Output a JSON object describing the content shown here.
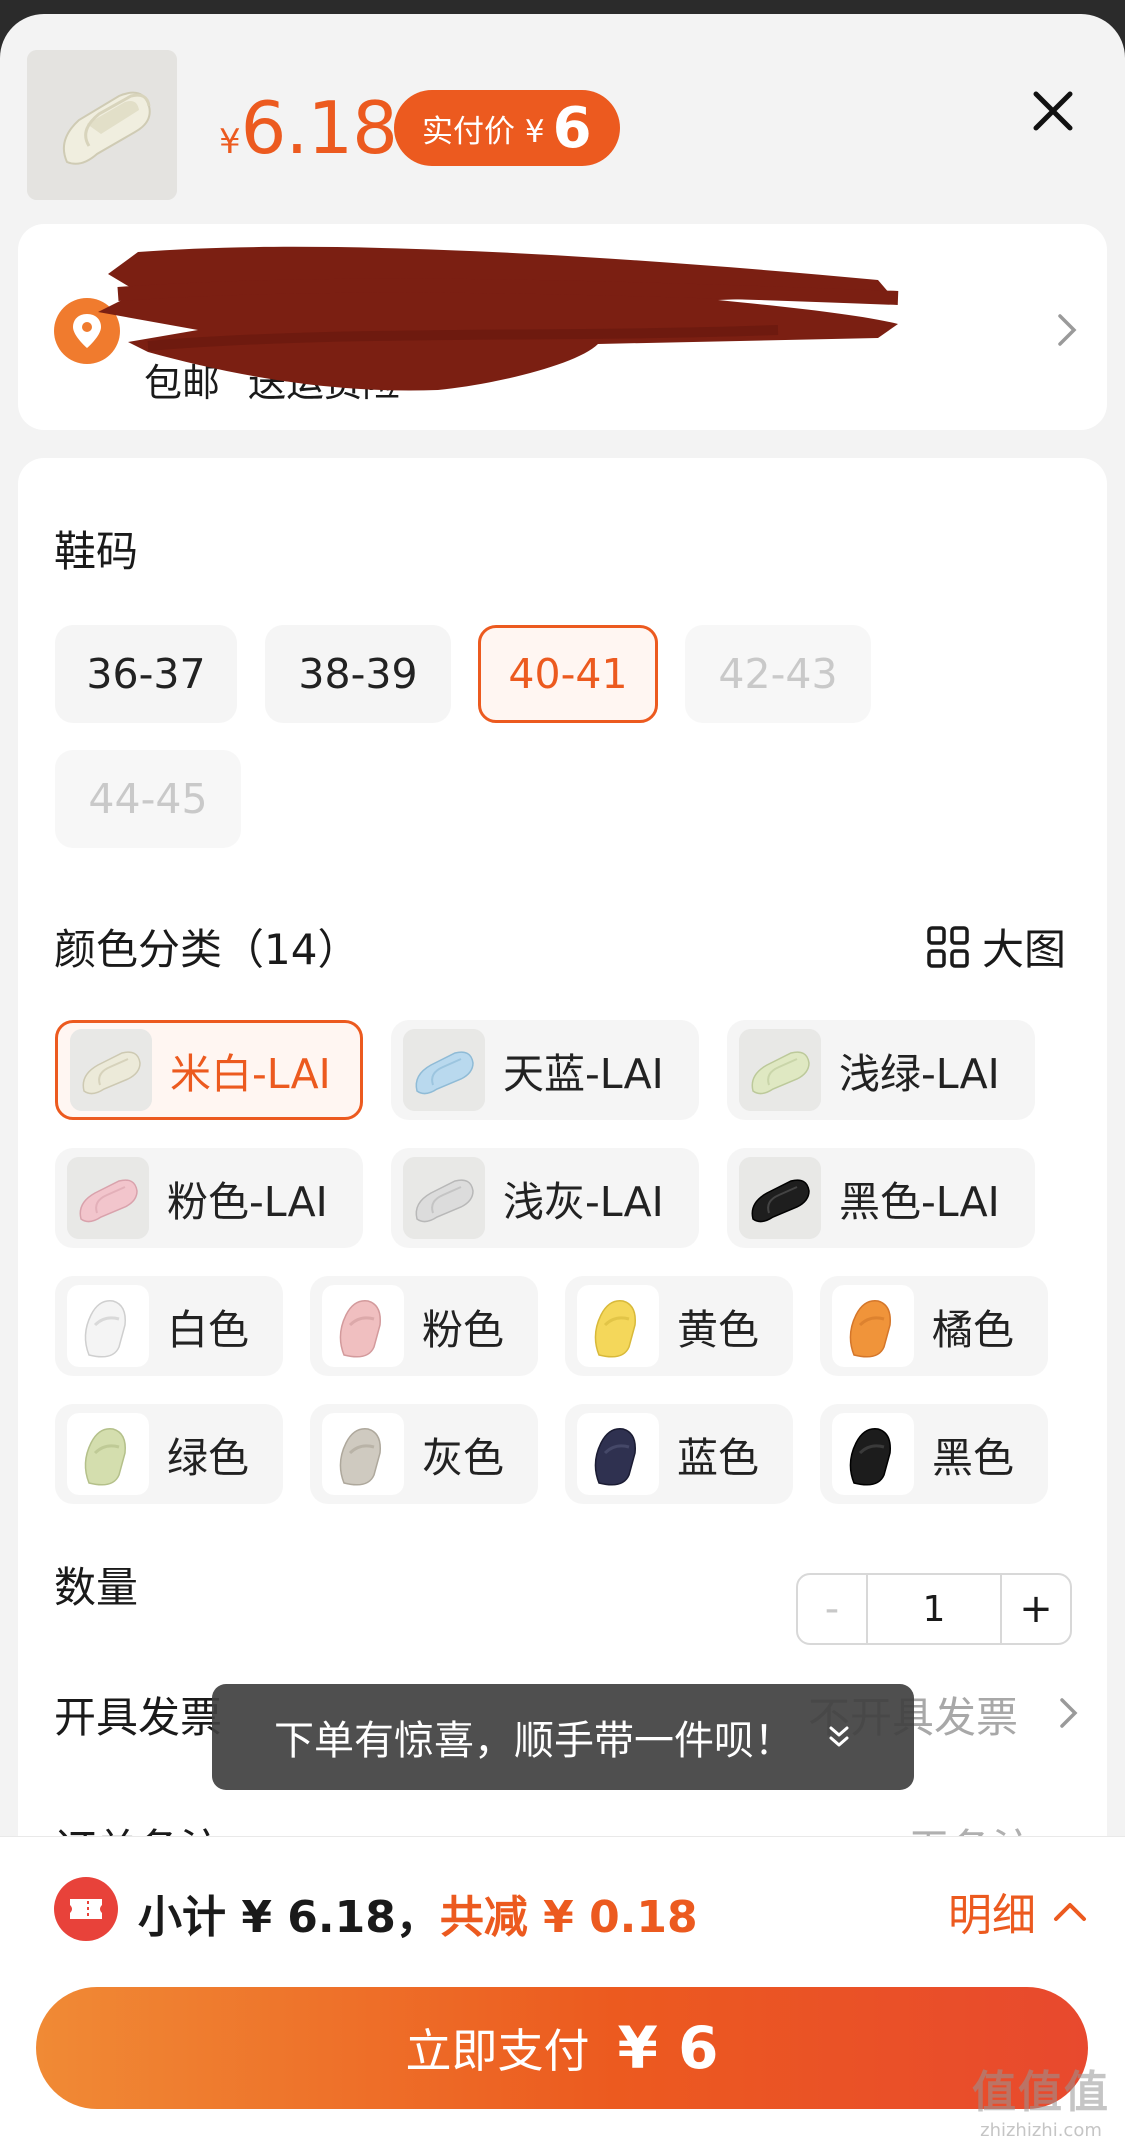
{
  "header": {
    "price_currency": "¥",
    "price_value": "6.18",
    "paid_label": "实付价 ¥",
    "paid_value": "6",
    "product_thumb_icon": "slipper-cream-icon",
    "close_icon": "close-icon"
  },
  "address": {
    "icon": "location-pin-icon",
    "pin_color": "#f07b2e",
    "free_shipping": "包邮",
    "shipping_insurance": "送运费险",
    "redacted": true
  },
  "size": {
    "title": "鞋码",
    "options": [
      {
        "label": "36-37",
        "state": "normal"
      },
      {
        "label": "38-39",
        "state": "normal"
      },
      {
        "label": "40-41",
        "state": "selected"
      },
      {
        "label": "42-43",
        "state": "disabled"
      },
      {
        "label": "44-45",
        "state": "disabled"
      }
    ]
  },
  "color": {
    "title": "颜色分类（14）",
    "big_image_label": "大图",
    "options": [
      {
        "label": "米白-LAI",
        "swatch": "#e9e7d8",
        "selected": true
      },
      {
        "label": "天蓝-LAI",
        "swatch": "#b9d9ee"
      },
      {
        "label": "浅绿-LAI",
        "swatch": "#dfe8c2"
      },
      {
        "label": "粉色-LAI",
        "swatch": "#f2c5cc"
      },
      {
        "label": "浅灰-LAI",
        "swatch": "#dcdcdc"
      },
      {
        "label": "黑色-LAI",
        "swatch": "#1e1e1e"
      },
      {
        "label": "白色",
        "swatch": "#f4f4f4"
      },
      {
        "label": "粉色",
        "swatch": "#f0bfc0"
      },
      {
        "label": "黄色",
        "swatch": "#f4d75a"
      },
      {
        "label": "橘色",
        "swatch": "#f0943a"
      },
      {
        "label": "绿色",
        "swatch": "#d4deae"
      },
      {
        "label": "灰色",
        "swatch": "#cfcac0"
      },
      {
        "label": "蓝色",
        "swatch": "#2f3150"
      },
      {
        "label": "黑色",
        "swatch": "#1c1c1c"
      }
    ]
  },
  "quantity": {
    "label": "数量",
    "minus": "-",
    "value": "1",
    "plus": "+"
  },
  "invoice": {
    "label": "开具发票",
    "value": "不开具发票"
  },
  "remark": {
    "label": "订单备注",
    "value": "无备注"
  },
  "toast": {
    "text": "下单有惊喜，顺手带一件呗！"
  },
  "footer": {
    "subtotal_label": "小计 ¥ 6.18，",
    "discount_label": "共减 ¥ 0.18",
    "detail_label": "明细",
    "pay_label": "立即支付",
    "pay_amount": "¥ 6",
    "accent": "#ec5a1f"
  },
  "watermark": {
    "main": "值值值",
    "sub": "zhizhizhi.com"
  }
}
